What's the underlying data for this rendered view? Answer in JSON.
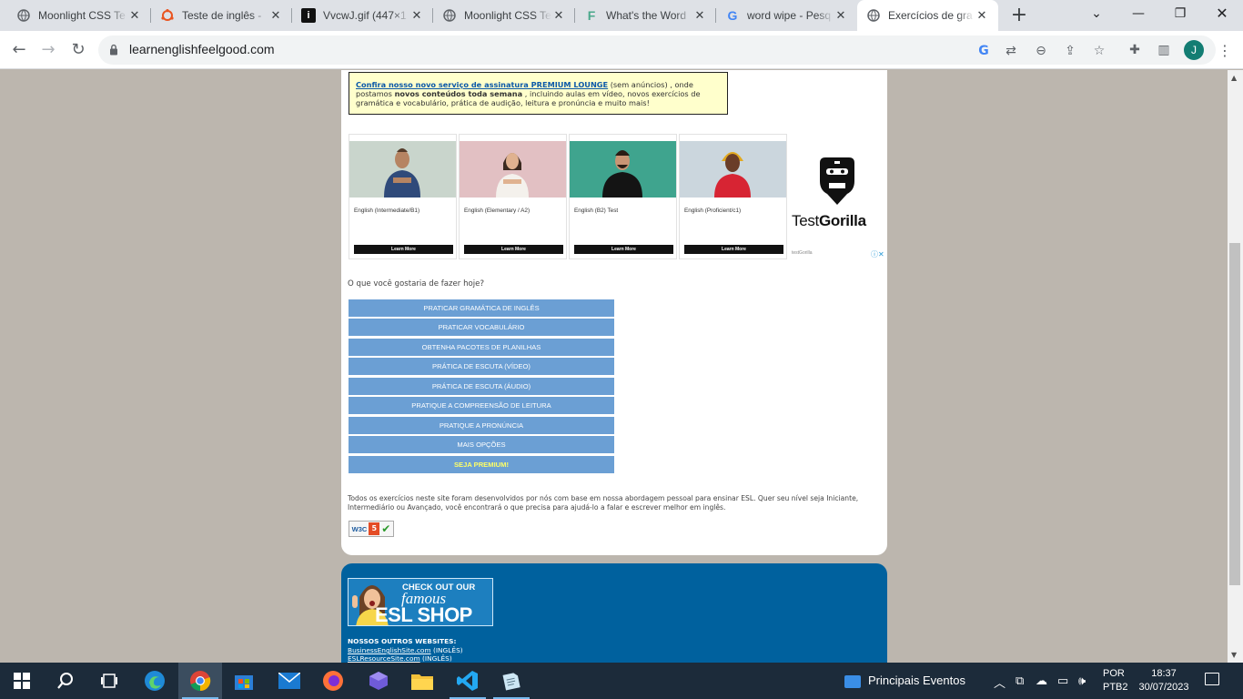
{
  "browser": {
    "tabs": [
      {
        "title": "Moonlight CSS Te",
        "icon": "globe-icon"
      },
      {
        "title": "Teste de inglês - ",
        "icon": "ubuntu-icon"
      },
      {
        "title": "VvcwJ.gif (447×1",
        "icon": "gif-icon"
      },
      {
        "title": "Moonlight CSS Te",
        "icon": "globe-icon"
      },
      {
        "title": "What's the Word",
        "icon": "f-icon"
      },
      {
        "title": "word wipe - Pesq",
        "icon": "google-icon"
      },
      {
        "title": "Exercícios de gra",
        "icon": "globe-icon",
        "active": true
      }
    ],
    "url": "learnenglishfeelgood.com",
    "profile_initial": "J"
  },
  "promo": {
    "link": "Confira nosso novo serviço de assinatura PREMIUM LOUNGE",
    "part1": " (sem anúncios) , onde postamos ",
    "bold": "novos conteúdos toda semana",
    "part2": " , incluindo aulas em vídeo, novos exercícios de gramática e vocabulário, prática de audição, leitura e pronúncia e muito mais!"
  },
  "ad": {
    "cards": [
      {
        "label": "English (Intermediate/B1)",
        "button": "Learn More"
      },
      {
        "label": "English (Elementary / A2)",
        "button": "Learn More"
      },
      {
        "label": "English (B2) Test",
        "button": "Learn More"
      },
      {
        "label": "English (Proficient/c1)",
        "button": "Learn More"
      }
    ],
    "brand_light": "Test",
    "brand_bold": "Gorilla",
    "small": "testGorilla"
  },
  "question": "O que você gostaria de fazer hoje?",
  "menu": [
    "PRATICAR GRAMÁTICA DE INGLÊS",
    "PRATICAR VOCABULÁRIO",
    "OBTENHA PACOTES DE PLANILHAS",
    "PRÁTICA DE ESCUTA (VÍDEO)",
    "PRÁTICA DE ESCUTA (ÁUDIO)",
    "PRATIQUE A COMPREENSÃO DE LEITURA",
    "PRATIQUE A PRONÚNCIA",
    "MAIS OPÇÕES",
    "SEJA PREMIUM!"
  ],
  "footer_text": "Todos os exercícios neste site foram desenvolvidos por nós com base em nossa abordagem pessoal para ensinar ESL. Quer seu nível seja Iniciante, Intermediário ou Avançado, você encontrará o que precisa para ajudá-lo a falar e escrever melhor em inglês.",
  "badge": {
    "w3c": "W3C",
    "html": "5"
  },
  "shop": {
    "line1": "CHECK OUT OUR",
    "line2": "famous",
    "line3": "ESL SHOP"
  },
  "other_sites": {
    "heading": "NOSSOS OUTROS WEBSITES:",
    "links": [
      {
        "name": "BusinessEnglishSite.com",
        "lang": " (INGLÊS)"
      },
      {
        "name": "ESLResourceSite.com",
        "lang": " (INGLÊS)"
      }
    ]
  },
  "taskbar": {
    "news": "Principais Eventos",
    "lang1": "POR",
    "lang2": "PTB2",
    "time": "18:37",
    "date": "30/07/2023"
  },
  "colors": {
    "menu_button": "#6b9fd4",
    "footer_blue": "#00619e",
    "premium_text": "#ffff66",
    "promo_bg": "#ffffcc"
  }
}
